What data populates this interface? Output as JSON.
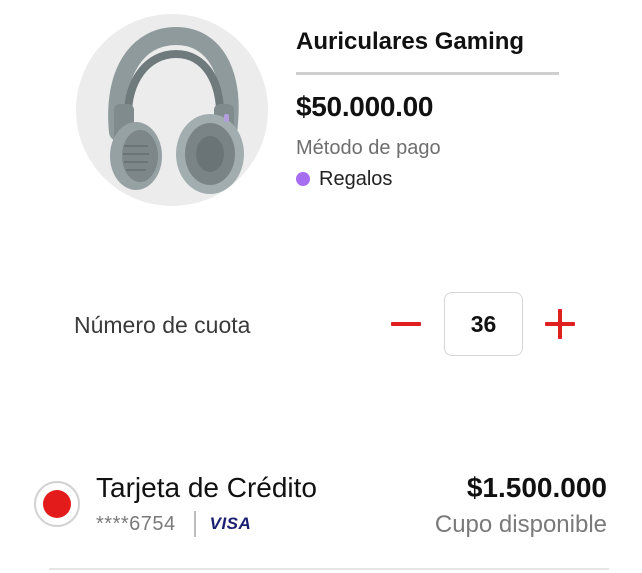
{
  "product": {
    "name": "Auriculares Gaming",
    "price": "$50.000.00",
    "payment_method_label": "Método de pago",
    "payment_method_value": "Regalos",
    "image_icon": "headphones-icon",
    "method_dot_color": "#a56df0"
  },
  "installments": {
    "label": "Número de cuota",
    "value": "36",
    "decrement_icon": "minus-icon",
    "increment_icon": "plus-icon",
    "accent_color": "#e02020"
  },
  "payment_card": {
    "title": "Tarjeta de Crédito",
    "masked_number": "****6754",
    "brand": "VISA",
    "amount": "$1.500.000",
    "caption": "Cupo disponible",
    "selected": true,
    "radio_color": "#e41b1b"
  }
}
